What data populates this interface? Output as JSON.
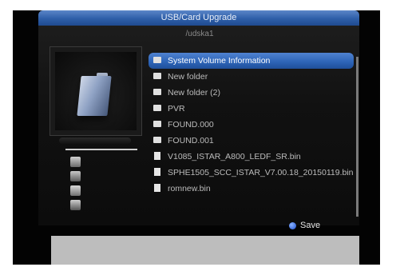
{
  "window": {
    "title": "USB/Card Upgrade",
    "path": "/udska1"
  },
  "files": [
    {
      "name": "System Volume Information",
      "type": "folder",
      "selected": true
    },
    {
      "name": "New folder",
      "type": "folder"
    },
    {
      "name": "New folder (2)",
      "type": "folder"
    },
    {
      "name": "PVR",
      "type": "folder"
    },
    {
      "name": "FOUND.000",
      "type": "folder"
    },
    {
      "name": "FOUND.001",
      "type": "folder"
    },
    {
      "name": "V1085_ISTAR_A800_LEDF_SR.bin",
      "type": "file"
    },
    {
      "name": "SPHE1505_SCC_ISTAR_V7.00.18_20150119.bin",
      "type": "file"
    },
    {
      "name": "romnew.bin",
      "type": "file"
    }
  ],
  "actions": {
    "save_label": "Save"
  },
  "colors": {
    "accent": "#2c63b6",
    "save_dot": "#1d4fd0"
  }
}
